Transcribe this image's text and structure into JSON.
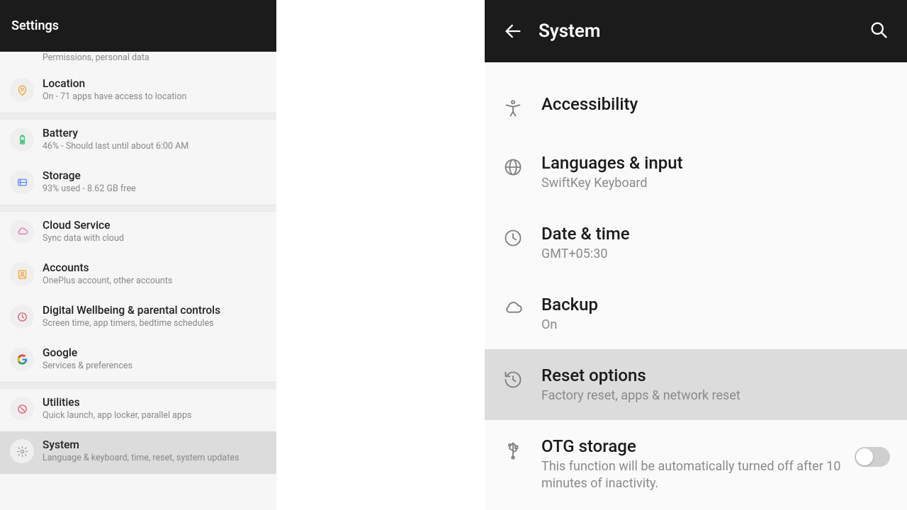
{
  "left": {
    "header": "Settings",
    "items": [
      {
        "title": "",
        "sub": "Permissions, personal data",
        "icon": "shield",
        "partial": true
      },
      {
        "title": "Location",
        "sub": "On - 71 apps have access to location",
        "icon": "location"
      },
      {
        "gap": true
      },
      {
        "title": "Battery",
        "sub": "46% - Should last until about 6:00 AM",
        "icon": "battery"
      },
      {
        "title": "Storage",
        "sub": "93% used - 8.62 GB free",
        "icon": "storage"
      },
      {
        "gap": true
      },
      {
        "title": "Cloud Service",
        "sub": "Sync data with cloud",
        "icon": "cloud"
      },
      {
        "title": "Accounts",
        "sub": "OnePlus account, other accounts",
        "icon": "account"
      },
      {
        "title": "Digital Wellbeing & parental controls",
        "sub": "Screen time, app timers, bedtime schedules",
        "icon": "wellbeing"
      },
      {
        "title": "Google",
        "sub": "Services & preferences",
        "icon": "google"
      },
      {
        "gap": true
      },
      {
        "title": "Utilities",
        "sub": "Quick launch, app locker, parallel apps",
        "icon": "utilities"
      },
      {
        "title": "System",
        "sub": "Language & keyboard, time, reset, system updates",
        "icon": "system",
        "active": true
      }
    ]
  },
  "right": {
    "header": "System",
    "items": [
      {
        "title": "Accessibility",
        "sub": "",
        "icon": "accessibility"
      },
      {
        "title": "Languages & input",
        "sub": "SwiftKey Keyboard",
        "icon": "globe"
      },
      {
        "title": "Date & time",
        "sub": "GMT+05:30",
        "icon": "clock"
      },
      {
        "title": "Backup",
        "sub": "On",
        "icon": "cloud"
      },
      {
        "title": "Reset options",
        "sub": "Factory reset, apps & network reset",
        "icon": "restore",
        "highlight": true
      },
      {
        "title": "OTG storage",
        "sub": "This function will be automatically turned off after 10 minutes of inactivity.",
        "icon": "usb",
        "toggle": "off"
      }
    ]
  }
}
